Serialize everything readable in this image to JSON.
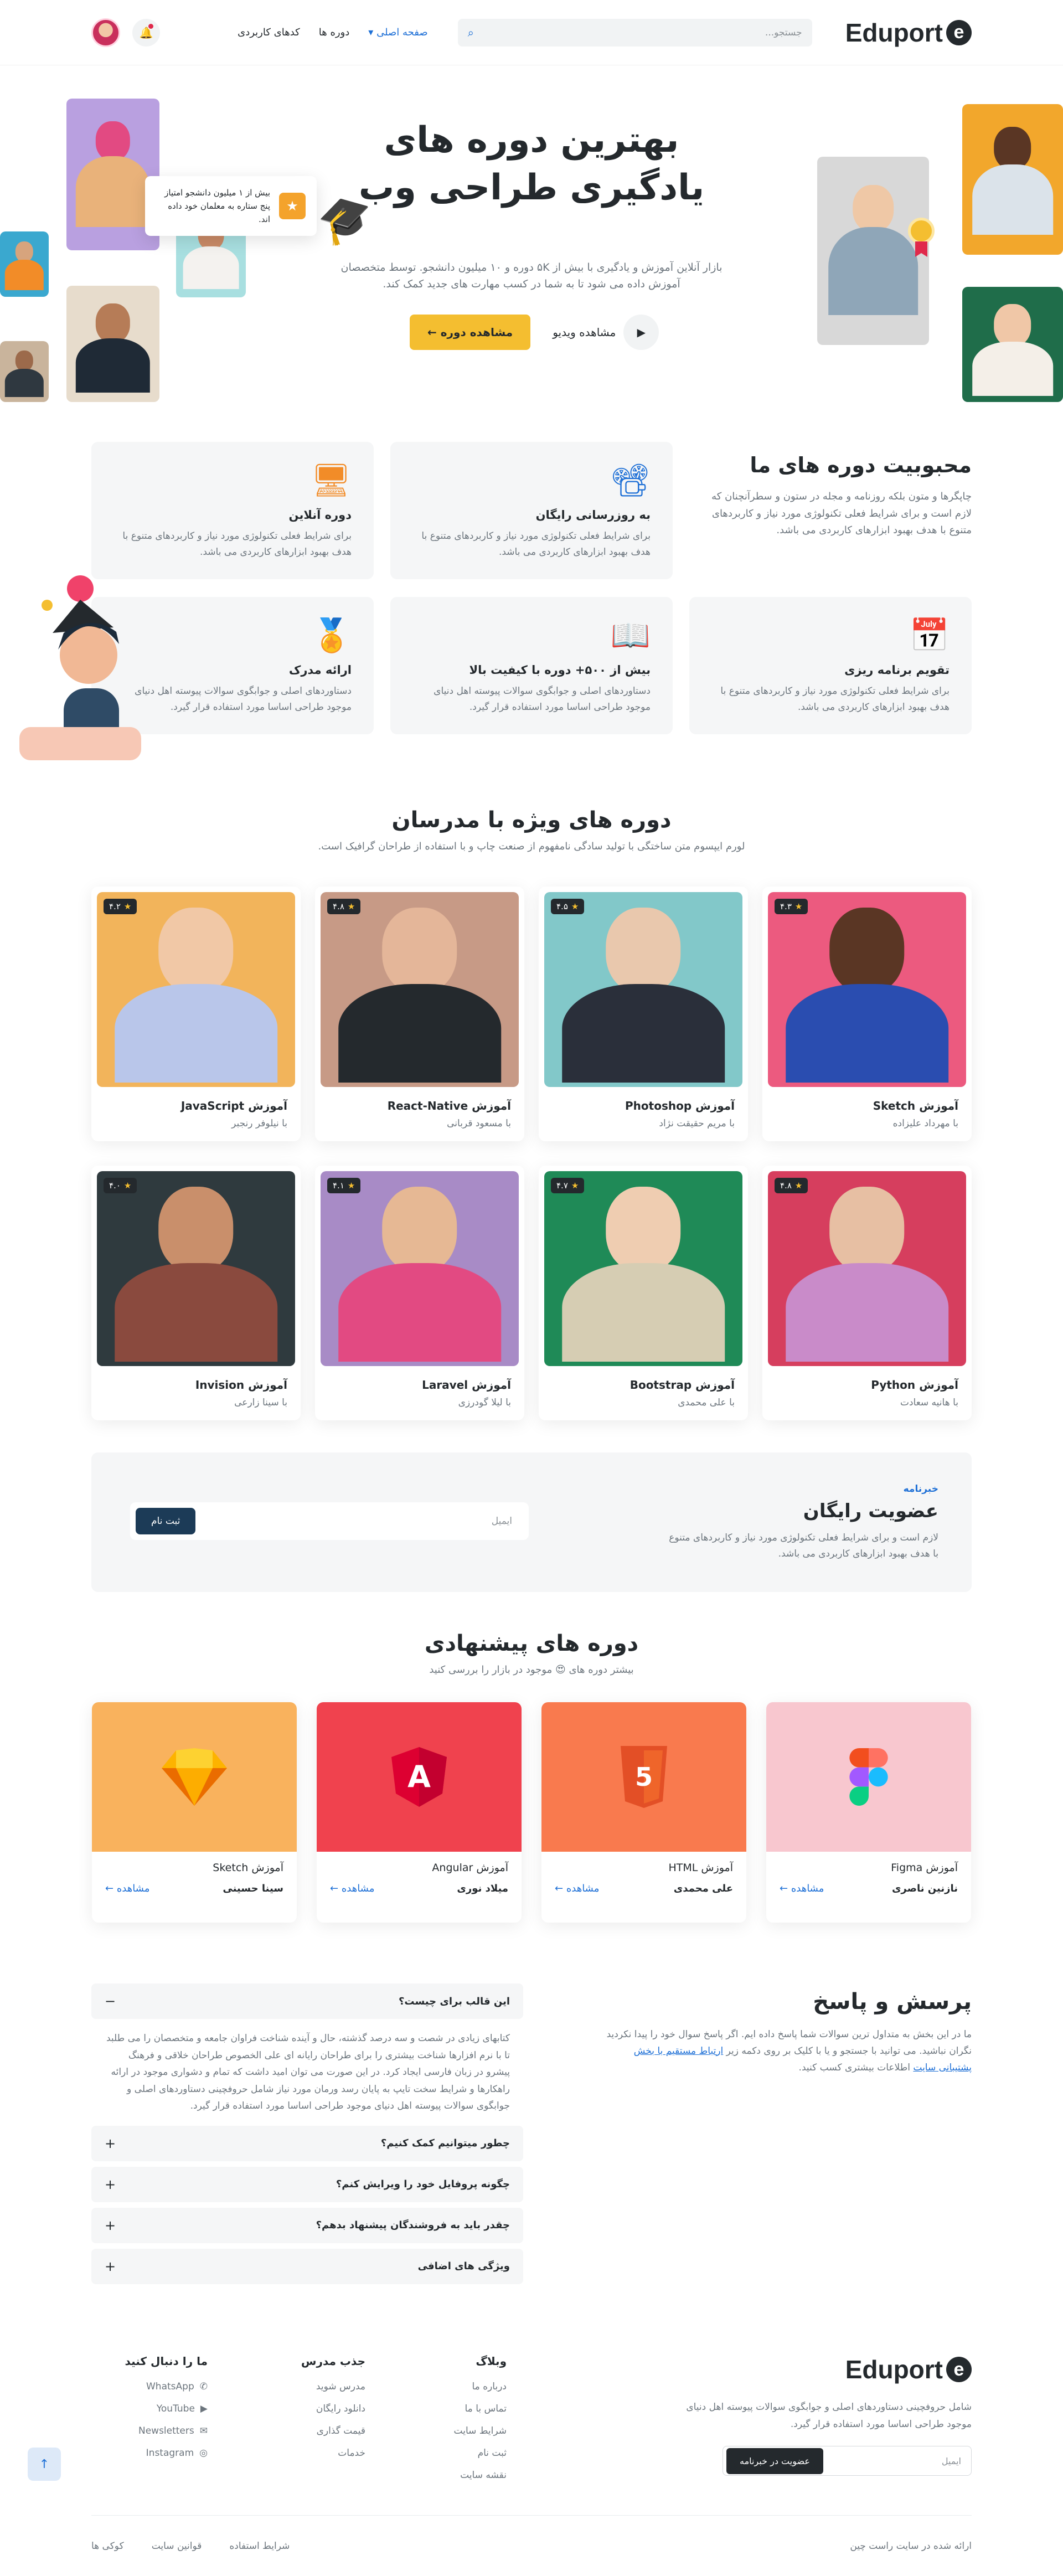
{
  "brand": {
    "name": "Eduport"
  },
  "nav": {
    "search_placeholder": "جستجو...",
    "menu": [
      "صفحه اصلی",
      "دوره ها",
      "کدهای کاربردی"
    ],
    "active_menu_chevron": "▾"
  },
  "hero": {
    "title": "بهترین دوره های یادگیری طراحی وب",
    "desc": "بازار آنلاین آموزش و یادگیری با بیش از ۵K دوره و ۱۰ میلیون دانشجو. توسط متخصصان آموزش داده می شود تا به شما در کسب مهارت های جدید کمک کند.",
    "cta": "مشاهده دوره",
    "cta_arrow": "←",
    "video": "مشاهده ویدیو",
    "star_card": "بیش از ۱ میلیون دانشجو امتیاز پنج ستاره به معلمان خود داده اند."
  },
  "popularity": {
    "title": "محبوبیت دوره های ما",
    "desc": "چاپگرها و متون بلکه روزنامه و مجله در ستون و سطرآنچنان که لازم است و برای شرایط فعلی تکنولوژی مورد نیاز و کاربردهای متنوع با هدف بهبود ابزارهای کاربردی می باشد.",
    "features": [
      {
        "icon": "projector-icon",
        "title": "به روزرسانی رایگان",
        "text": "برای شرایط فعلی تکنولوژی مورد نیاز و کاربردهای متنوع با هدف بهبود ابزارهای کاربردی می باشد.",
        "color": "#1d6fd6"
      },
      {
        "icon": "online-course-icon",
        "title": "دوره آنلاین",
        "text": "برای شرایط فعلی تکنولوژی مورد نیاز و کاربردهای متنوع با هدف بهبود ابزارهای کاربردی می باشد.",
        "color": "#f28c28"
      },
      {
        "icon": "calendar-icon",
        "title": "تقویم برنامه ریزی",
        "text": "برای شرایط فعلی تکنولوژی مورد نیاز و کاربردهای متنوع با هدف بهبود ابزارهای کاربردی می باشد.",
        "color": "#7c4fd6"
      },
      {
        "icon": "book-icon",
        "title": "بیش از ۵۰۰+ دوره با کیفیت بالا",
        "text": "دستاوردهای اصلی و جوابگوی سوالات پیوسته اهل دنیای موجود طراحی اساسا مورد استفاده قرار گیرد.",
        "color": "#f4be30"
      },
      {
        "icon": "certificate-icon",
        "title": "ارائه مدرک",
        "text": "دستاوردهای اصلی و جوابگوی سوالات پیوسته اهل دنیای موجود طراحی اساسا مورد استفاده قرار گیرد.",
        "color": "#1fa37a"
      }
    ]
  },
  "teachers_section": {
    "title": "دوره های ویژه با مدرسان",
    "subtitle": "لورم ایپسوم متن ساختگی با تولید سادگی نامفهوم از صنعت چاپ و با استفاده از طراحان گرافیک است.",
    "cards": [
      {
        "title": "آموزش Sketch",
        "by": "با مهرداد علیزاده",
        "rating": "۴.۳",
        "bg": "#ec5a7f",
        "skin": "#5a3624",
        "cloth": "#2a4db0"
      },
      {
        "title": "آموزش Photoshop",
        "by": "با مریم حقیقت نژاد",
        "rating": "۴.۵",
        "bg": "#82c8c9",
        "skin": "#e9c8ad",
        "cloth": "#2a2f3a"
      },
      {
        "title": "آموزش React-Native",
        "by": "با مسعود قربانی",
        "rating": "۴.۸",
        "bg": "#c79a86",
        "skin": "#e4b699",
        "cloth": "#24292d"
      },
      {
        "title": "آموزش JavaScript",
        "by": "با نیلوفر رنجبر",
        "rating": "۴.۲",
        "bg": "#f2b45b",
        "skin": "#f1c8a6",
        "cloth": "#b9c6ea"
      },
      {
        "title": "آموزش Python",
        "by": "با هانیه سعادت",
        "rating": "۴.۸",
        "bg": "#d63e5e",
        "skin": "#e7bfa3",
        "cloth": "#c98bc9"
      },
      {
        "title": "آموزش Bootstrap",
        "by": "با علی محمدی",
        "rating": "۴.۷",
        "bg": "#1f8a57",
        "skin": "#efcdb1",
        "cloth": "#d6cdb3"
      },
      {
        "title": "آموزش Laravel",
        "by": "با لیلا گودرزی",
        "rating": "۴.۱",
        "bg": "#a88bc6",
        "skin": "#e6b894",
        "cloth": "#e24a82"
      },
      {
        "title": "آموزش Invision",
        "by": "با سینا زارعی",
        "rating": "۴.۰",
        "bg": "#2f3a3e",
        "skin": "#c98f6b",
        "cloth": "#8a4a3e"
      }
    ]
  },
  "newsletter": {
    "tag": "خبرنامه",
    "title": "عضویت رایگان",
    "desc": "لازم است و برای شرایط فعلی تکنولوژی مورد نیاز و کاربردهای متنوع با هدف بهبود ابزارهای کاربردی می باشد.",
    "placeholder": "ایمیل",
    "button": "ثبت نام"
  },
  "suggested": {
    "title": "دوره های پیشنهادی",
    "subtitle": "بیشتر دوره های 😍 موجود در بازار را بررسی کنید",
    "view_label": "مشاهده",
    "view_arrow": "←",
    "cards": [
      {
        "title": "آموزش Figma",
        "name": "نازنین ناصری",
        "logo": "figma-logo-icon",
        "bg": "#f8c7cf"
      },
      {
        "title": "آموزش HTML",
        "name": "علی محمدی",
        "logo": "html5-logo-icon",
        "bg": "#f97a4e"
      },
      {
        "title": "آموزش Angular",
        "name": "میلاد نوری",
        "logo": "angular-logo-icon",
        "bg": "#f0424e"
      },
      {
        "title": "آموزش Sketch",
        "name": "سینا حسینی",
        "logo": "sketch-logo-icon",
        "bg": "#f9b25d"
      }
    ]
  },
  "faq": {
    "title": "پرسش و پاسخ",
    "desc_before": "ما در این بخش به متداول ترین سوالات شما پاسخ داده ایم. اگر پاسخ سوال خود را پیدا نکردید نگران نباشید. می توانید با جستجو و یا با کلیک بر روی دکمه زیر",
    "link": "ارتباط مستقیم با بخش پشتیبانی سایت",
    "desc_after": "اطلاعات بیشتری کسب کنید.",
    "items": [
      {
        "q": "این قالب برای چیست؟",
        "a": "کتابهای زیادی در شصت و سه درصد گذشته، حال و آینده شناخت فراوان جامعه و متخصصان را می طلبد تا با نرم افزارها شناخت بیشتری را برای طراحان رایانه ای علی الخصوص طراحان خلاقی و فرهنگ پیشرو در زبان فارسی ایجاد کرد. در این صورت می توان امید داشت که تمام و دشواری موجود در ارائه راهکارها و شرایط سخت تایپ به پایان رسد ورمان مورد نیاز شامل حروفچینی دستاوردهای اصلی و جوابگوی سوالات پیوسته اهل دنیای موجود طراحی اساسا مورد استفاده قرار گیرد.",
        "open": true,
        "sign": "−"
      },
      {
        "q": "چطور میتوانیم کمک کنیم؟",
        "sign": "+"
      },
      {
        "q": "چگونه پروفایل خود را ویرایش کنم؟",
        "sign": "+"
      },
      {
        "q": "چقدر باید به فروشندگان پیشنهاد بدهم؟",
        "sign": "+"
      },
      {
        "q": "ویژگی های اضافی",
        "sign": "+"
      }
    ]
  },
  "footer": {
    "desc": "شامل حروفچینی دستاوردهای اصلی و جوابگوی سوالات پیوسته اهل دنیای موجود طراحی اساسا مورد استفاده قرار گیرد.",
    "email_placeholder": "ایمیل",
    "subscribe": "عضویت در خبرنامه",
    "columns": [
      {
        "title": "وبلاگ",
        "items": [
          "درباره ما",
          "تماس با ما",
          "شرایط سایت",
          "ثبت نام",
          "نقشه سایت"
        ]
      },
      {
        "title": "جذب مدرس",
        "items": [
          "مدرس شوید",
          "دانلود رایگان",
          "قیمت گذاری",
          "خدمات"
        ]
      },
      {
        "title": "ما را دنبال کنید",
        "items": [
          "WhatsApp",
          "YouTube",
          "Newsletters",
          "Instagram"
        ]
      }
    ],
    "copyright": "ارائه شده در سایت راست چین",
    "links": [
      "شرایط استفاده",
      "قوانین سایت",
      "کوکی ها"
    ]
  },
  "colors": {
    "accent": "#1d6fd6",
    "primary_btn": "#f4be30",
    "dark": "#24292d",
    "soft_bg": "#f5f6f7"
  }
}
